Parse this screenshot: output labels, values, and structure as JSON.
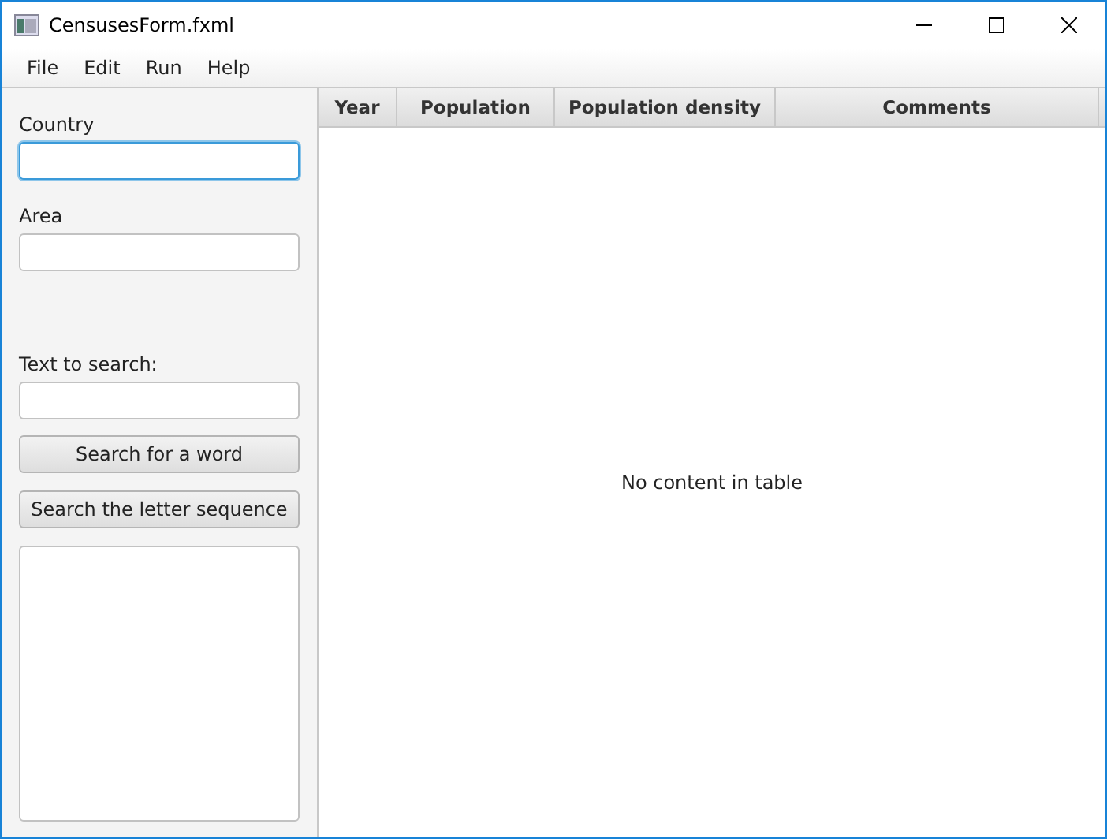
{
  "window": {
    "title": "CensusesForm.fxml"
  },
  "menu": [
    "File",
    "Edit",
    "Run",
    "Help"
  ],
  "form": {
    "fields": [
      {
        "label": "Country",
        "focused": true
      },
      {
        "label": "Area",
        "focused": false
      },
      {
        "label": "Text to search:",
        "focused": false
      }
    ],
    "buttons": [
      "Search for a word",
      "Search the letter sequence"
    ]
  },
  "table": {
    "columns": [
      "Year",
      "Population",
      "Population density",
      "Comments"
    ],
    "placeholder": "No content in table"
  }
}
